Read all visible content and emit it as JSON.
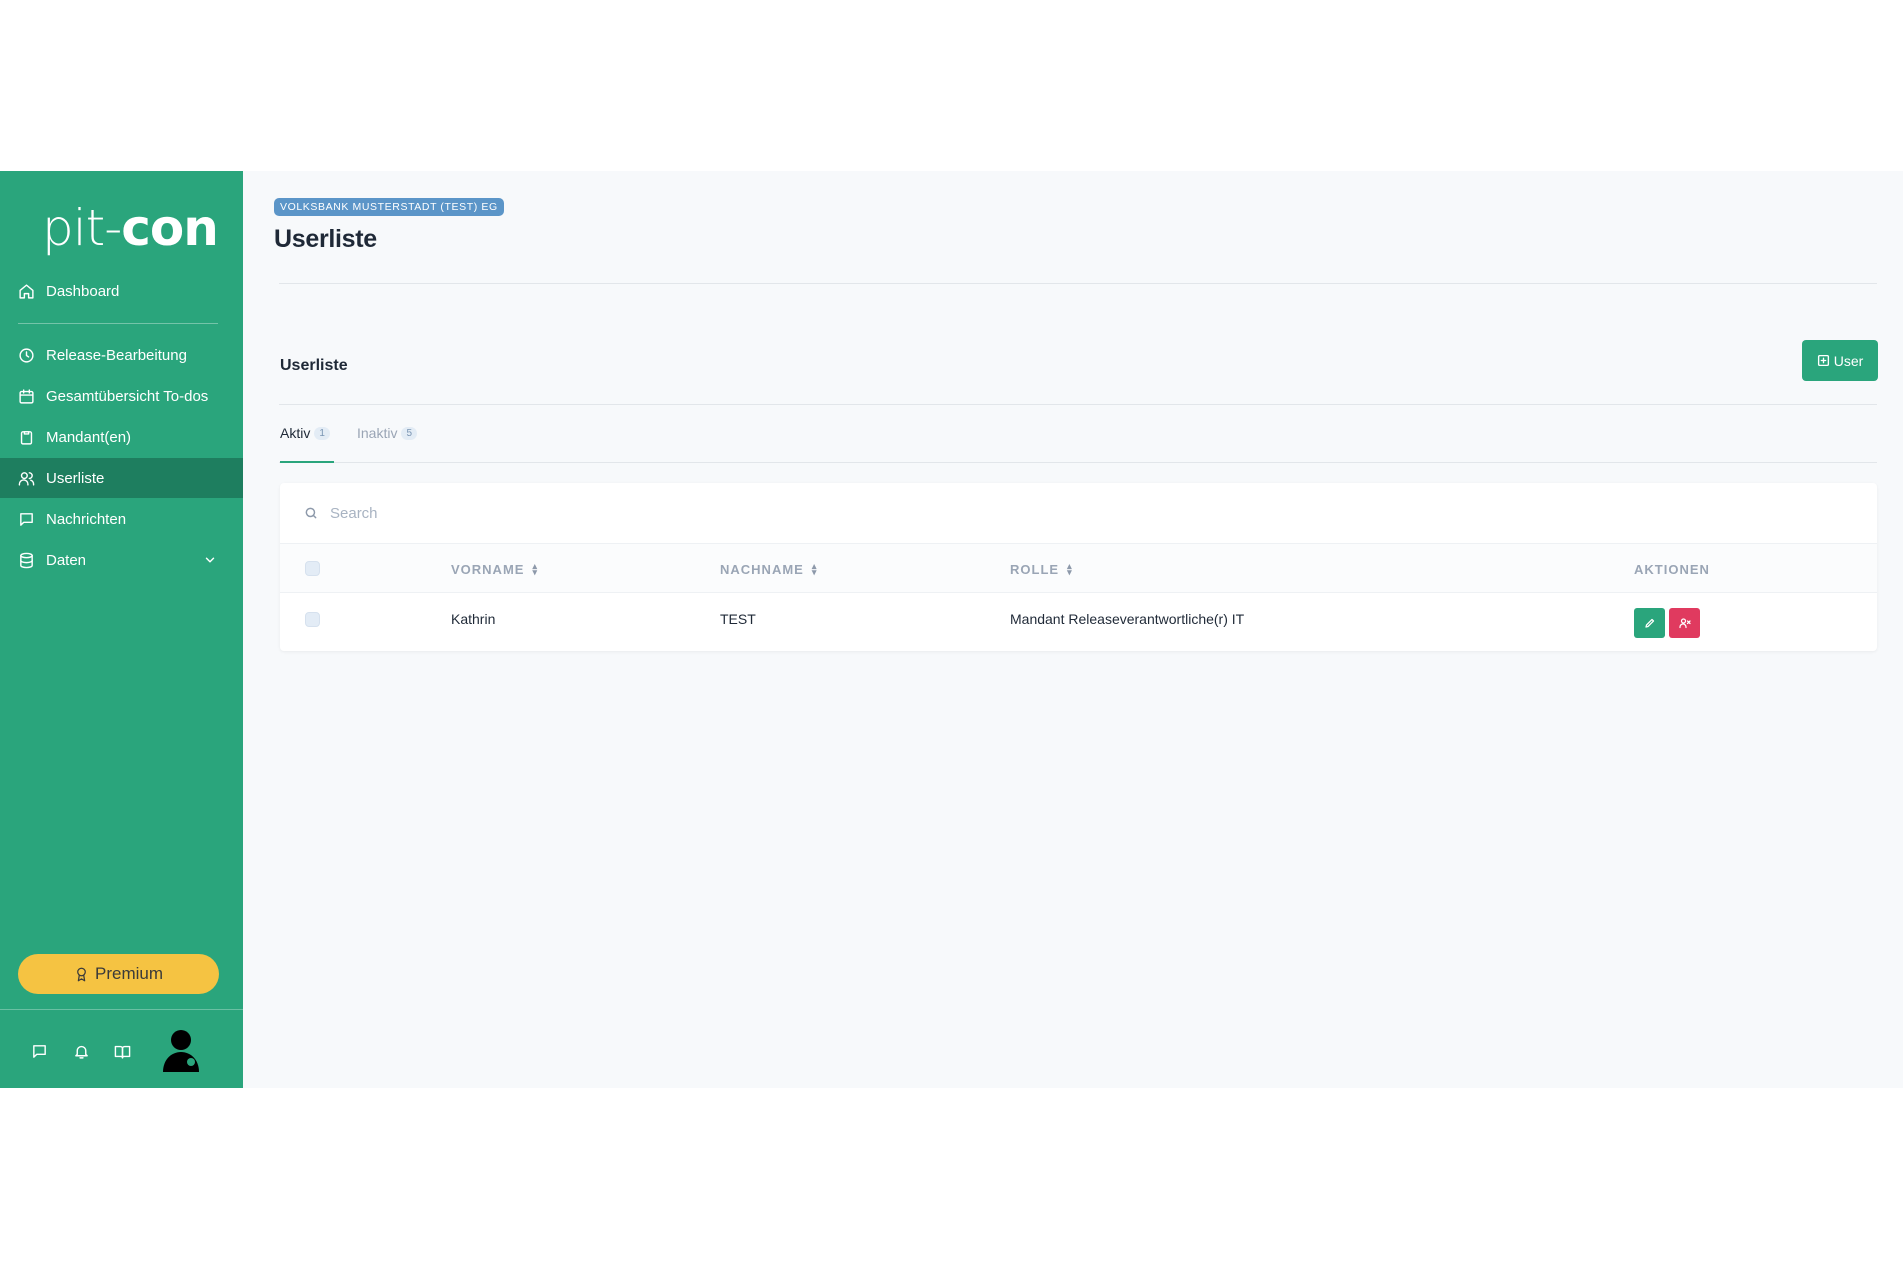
{
  "sidebar": {
    "logo_light": "pit-",
    "logo_bold": "con",
    "items": [
      {
        "label": "Dashboard",
        "icon": "home-icon"
      },
      {
        "label": "Release-Bearbeitung",
        "icon": "clock-icon"
      },
      {
        "label": "Gesamtübersicht To-dos",
        "icon": "calendar-icon"
      },
      {
        "label": "Mandant(en)",
        "icon": "clipboard-icon"
      },
      {
        "label": "Userliste",
        "icon": "users-icon",
        "active": true
      },
      {
        "label": "Nachrichten",
        "icon": "message-icon"
      },
      {
        "label": "Daten",
        "icon": "database-icon",
        "has_submenu": true
      }
    ],
    "premium_label": "Premium",
    "bottom_icons": [
      "chat-icon",
      "bell-icon",
      "book-icon",
      "user-avatar"
    ]
  },
  "header": {
    "badge": "VOLKSBANK MUSTERSTADT (TEST) EG",
    "title": "Userliste"
  },
  "section": {
    "title": "Userliste",
    "add_button_label": "User"
  },
  "tabs": [
    {
      "label": "Aktiv",
      "count": "1",
      "active": true
    },
    {
      "label": "Inaktiv",
      "count": "5",
      "active": false
    }
  ],
  "search": {
    "placeholder": "Search",
    "value": ""
  },
  "table": {
    "columns": [
      "VORNAME",
      "NACHNAME",
      "ROLLE",
      "AKTIONEN"
    ],
    "rows": [
      {
        "vorname": "Kathrin",
        "nachname": "TEST",
        "rolle": "Mandant Releaseverantwortliche(r) IT"
      }
    ]
  },
  "colors": {
    "sidebar": "#2aa57c",
    "sidebar_active": "#1e7e5f",
    "premium": "#f5c342",
    "badge": "#5b95c8",
    "edit": "#2aa57c",
    "deactivate": "#e03a5f"
  }
}
